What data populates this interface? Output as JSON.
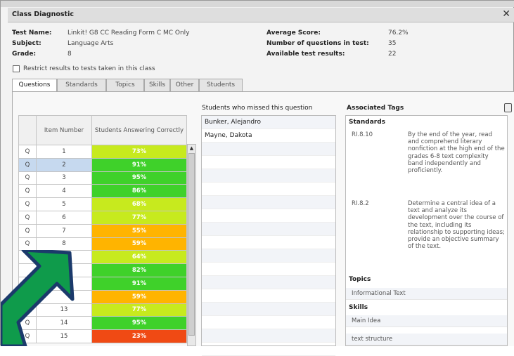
{
  "dialog": {
    "title": "Class Diagnostic",
    "close_glyph": "✕"
  },
  "info": {
    "test_name_label": "Test Name:",
    "test_name": "Linkit! G8 CC Reading Form C MC Only",
    "subject_label": "Subject:",
    "subject": "Language Arts",
    "grade_label": "Grade:",
    "grade": "8",
    "average_label": "Average Score:",
    "average": "76.2%",
    "questions_label": "Number of questions in test:",
    "questions": "35",
    "results_label": "Available test results:",
    "results": "22"
  },
  "restrict_label": "Restrict results to tests taken in this class",
  "tabs": [
    "Questions",
    "Standards",
    "Topics",
    "Skills",
    "Other",
    "Students"
  ],
  "grid": {
    "col_item": "Item Number",
    "col_correct": "Students Answering Correctly",
    "rows": [
      {
        "q": "Q",
        "num": "1",
        "pct": "73%",
        "color": "#c7ea1e"
      },
      {
        "q": "Q",
        "num": "2",
        "pct": "91%",
        "color": "#3fd12a"
      },
      {
        "q": "Q",
        "num": "3",
        "pct": "95%",
        "color": "#3fd12a"
      },
      {
        "q": "Q",
        "num": "4",
        "pct": "86%",
        "color": "#3fd12a"
      },
      {
        "q": "Q",
        "num": "5",
        "pct": "68%",
        "color": "#c7ea1e"
      },
      {
        "q": "Q",
        "num": "6",
        "pct": "77%",
        "color": "#c7ea1e"
      },
      {
        "q": "Q",
        "num": "7",
        "pct": "55%",
        "color": "#ffb400"
      },
      {
        "q": "Q",
        "num": "8",
        "pct": "59%",
        "color": "#ffb400"
      },
      {
        "q": "",
        "num": "",
        "pct": "64%",
        "color": "#c7ea1e"
      },
      {
        "q": "",
        "num": "",
        "pct": "82%",
        "color": "#3fd12a"
      },
      {
        "q": "",
        "num": "",
        "pct": "91%",
        "color": "#3fd12a"
      },
      {
        "q": "",
        "num": "",
        "pct": "59%",
        "color": "#ffb400"
      },
      {
        "q": "",
        "num": "13",
        "pct": "77%",
        "color": "#c7ea1e"
      },
      {
        "q": "Q",
        "num": "14",
        "pct": "95%",
        "color": "#3fd12a"
      },
      {
        "q": "Q",
        "num": "15",
        "pct": "23%",
        "color": "#f04a14"
      }
    ]
  },
  "missed": {
    "header": "Students who missed this question",
    "students": [
      "Bunker, Alejandro",
      "Mayne, Dakota"
    ]
  },
  "tags": {
    "header": "Associated Tags",
    "standards_label": "Standards",
    "standards": [
      {
        "code": "RI.8.10",
        "text": "By the end of the year, read and comprehend literary nonfiction at the high end of the grades 6-8 text complexity band independently and proficiently."
      },
      {
        "code": "RI.8.2",
        "text": "Determine a central idea of a text and analyze its development over the course of the text, including its relationship to supporting ideas; provide an objective summary of the text."
      }
    ],
    "topics_label": "Topics",
    "topics": [
      "Informational Text"
    ],
    "skills_label": "Skills",
    "skills": [
      "Main Idea",
      "text structure"
    ]
  },
  "colors": {
    "green": "#3fd12a",
    "yellow_green": "#c7ea1e",
    "orange": "#ffb400",
    "red": "#f04a14",
    "arrow": "#0f9b4b",
    "arrow_outline": "#1b3a6b"
  }
}
